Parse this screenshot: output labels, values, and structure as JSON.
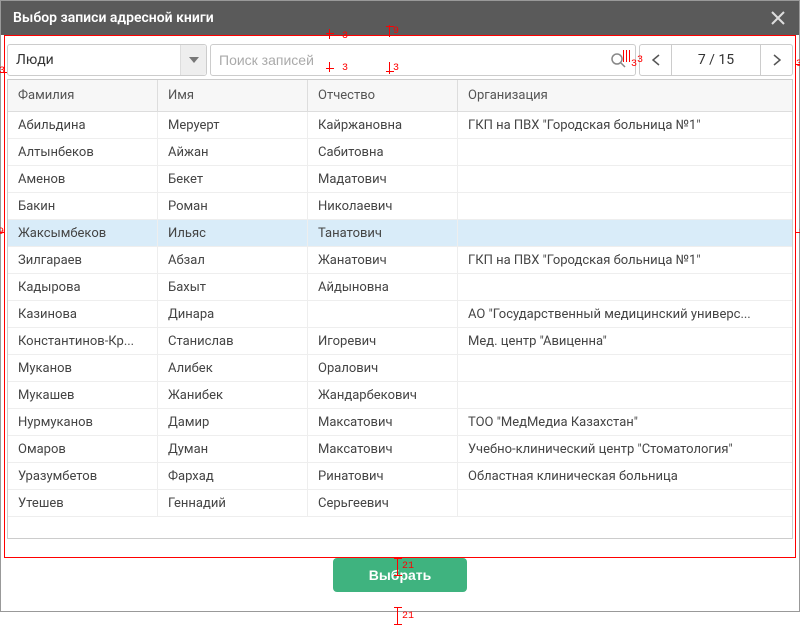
{
  "dialog": {
    "title": "Выбор записи адресной книги"
  },
  "toolbar": {
    "dropdown_value": "Люди",
    "search_placeholder": "Поиск записей",
    "pager_display": "7 / 15"
  },
  "table": {
    "headers": [
      "Фамилия",
      "Имя",
      "Отчество",
      "Организация"
    ],
    "selected_index": 4,
    "rows": [
      [
        "Абильдина",
        "Меруерт",
        "Кайржановна",
        "ГКП на ПВХ \"Городская больница №1\""
      ],
      [
        "Алтынбеков",
        "Айжан",
        "Сабитовна",
        ""
      ],
      [
        "Аменов",
        "Бекет",
        "Мадатович",
        ""
      ],
      [
        "Бакин",
        "Роман",
        "Николаевич",
        ""
      ],
      [
        "Жаксымбеков",
        "Ильяс",
        "Танатович",
        ""
      ],
      [
        "Зилгараев",
        "Абзал",
        "Жанатович",
        "ГКП на ПВХ \"Городская больница №1\""
      ],
      [
        "Кадырова",
        "Бахыт",
        "Айдыновна",
        ""
      ],
      [
        "Казинова",
        "Динара",
        "",
        "АО \"Государственный медицинский универс..."
      ],
      [
        "Константинов-Кр...",
        "Станислав",
        "Игоревич",
        "Мед. центр \"Авиценна\""
      ],
      [
        "Муканов",
        "Алибек",
        "Оралович",
        ""
      ],
      [
        "Мукашев",
        "Жанибек",
        "Жандарбекович",
        ""
      ],
      [
        "Нурмуканов",
        "Дамир",
        "Максатович",
        "ТОО \"МедМедиа Казахстан\""
      ],
      [
        "Омаров",
        "Думан",
        "Максатович",
        "Учебно-клинический центр \"Стоматология\""
      ],
      [
        "Уразумбетов",
        "Фархад",
        "Ринатович",
        "Областная клиническая больница"
      ],
      [
        "Утешев",
        "Геннадий",
        "Серьгеевич",
        ""
      ]
    ]
  },
  "footer": {
    "select_label": "Выбрать"
  },
  "annotations": {
    "top_9": "9",
    "gap_3": "3",
    "gap_21": "21",
    "side_9": "9"
  }
}
